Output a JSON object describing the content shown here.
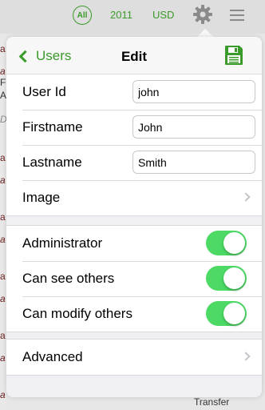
{
  "background": {
    "filter_chip": "All",
    "year": "2011",
    "currency": "USD",
    "footer_text": "Transfer",
    "left_fragments": [
      "a",
      "a",
      "F",
      "Ad",
      "Dé",
      "a",
      "a",
      "a",
      "a",
      "a",
      "a",
      "a",
      "a",
      "a"
    ]
  },
  "navbar": {
    "back_label": "Users",
    "title": "Edit"
  },
  "details": [
    {
      "label": "User Id",
      "value": "john"
    },
    {
      "label": "Firstname",
      "value": "John"
    },
    {
      "label": "Lastname",
      "value": "Smith"
    }
  ],
  "image_row": {
    "label": "Image"
  },
  "permissions": [
    {
      "label": "Administrator",
      "on": true
    },
    {
      "label": "Can see others",
      "on": true
    },
    {
      "label": "Can modify others",
      "on": true
    }
  ],
  "advanced_row": {
    "label": "Advanced"
  },
  "colors": {
    "accent": "#3a9a2a",
    "toggle_on": "#4cd964"
  }
}
